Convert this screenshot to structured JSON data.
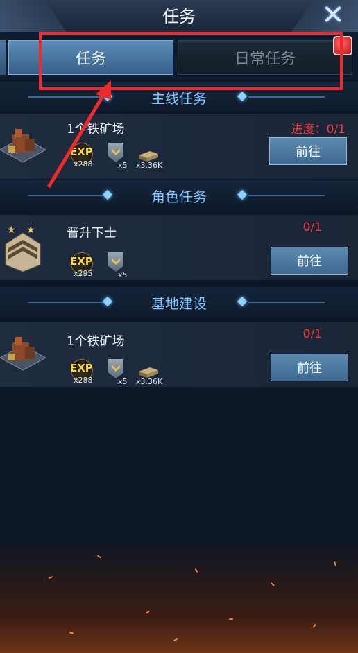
{
  "header": {
    "title": "任务"
  },
  "tabs": [
    {
      "label": "任务",
      "active": true
    },
    {
      "label": "日常任务",
      "active": false
    }
  ],
  "sections": [
    {
      "title": "主线任务",
      "task": {
        "name": "1个铁矿场",
        "progress": "进度：0/1",
        "button": "前往",
        "rewards": {
          "exp": "x288",
          "rank": "x5",
          "resource": "x3.36K"
        }
      }
    },
    {
      "title": "角色任务",
      "task": {
        "name": "晋升下士",
        "progress": "0/1",
        "button": "前往",
        "rewards": {
          "exp": "x295",
          "rank": "x5"
        }
      }
    },
    {
      "title": "基地建设",
      "task": {
        "name": "1个铁矿场",
        "progress": "0/1",
        "button": "前往",
        "rewards": {
          "exp": "x288",
          "rank": "x5",
          "resource": "x3.36K"
        }
      }
    }
  ],
  "icons": {
    "close": "close-icon",
    "exp": "exp-icon",
    "rank": "rank-medal-icon",
    "resource": "resource-bars-icon"
  },
  "colors": {
    "accent": "#7dc6ff",
    "progress": "#ef3c3c",
    "highlight": "#ef2a2a",
    "button": "#4c79a0"
  },
  "labels": {
    "exp_badge": "EXP"
  }
}
